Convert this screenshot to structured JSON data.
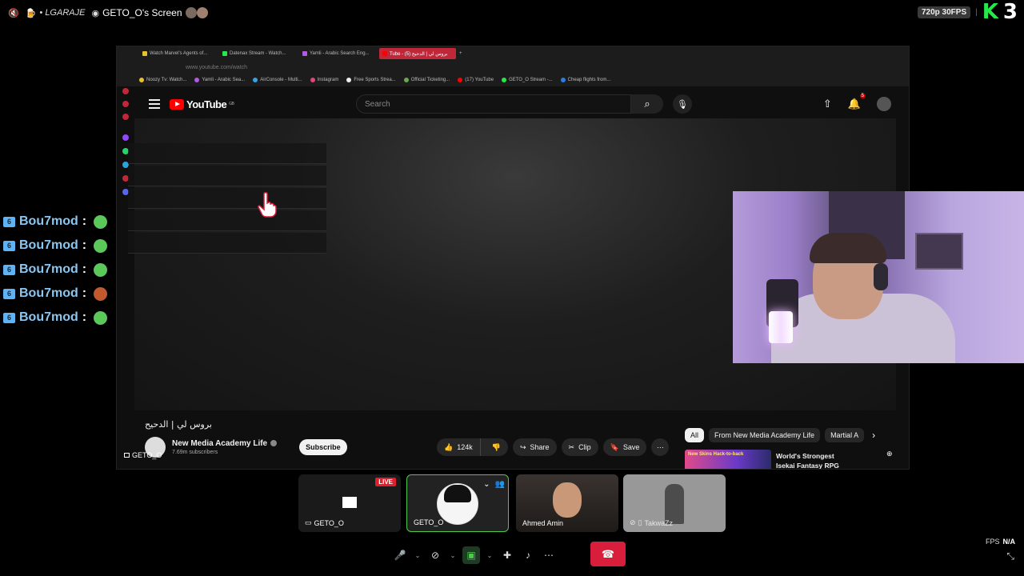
{
  "topbar": {
    "channel_label": "• LGARAJE",
    "screen_title": "GETO_O's Screen",
    "resolution": "720p 30FPS",
    "logo": "K",
    "logo_num": "3"
  },
  "browser": {
    "tabs": [
      {
        "label": "Watch Marvel's Agents of..."
      },
      {
        "label": "Datenax Stream - Watch..."
      },
      {
        "label": "Yamli - Arabic Search Eng..."
      },
      {
        "label": "Tube - بروس لي | الدحيح (5)"
      }
    ],
    "url": "www.youtube.com/watch",
    "bookmarks": [
      {
        "label": "Noozy Tv: Watch...",
        "color": "#e8c02b"
      },
      {
        "label": "Yamli - Arabic Sea...",
        "color": "#b05adf"
      },
      {
        "label": "AirConsole - Multi...",
        "color": "#3aa0e8"
      },
      {
        "label": "Instagram",
        "color": "#e0457b"
      },
      {
        "label": "Free Sports Strea...",
        "color": "#eeeeee"
      },
      {
        "label": "Official Ticketing...",
        "color": "#6aa84f"
      },
      {
        "label": "(17) YouTube",
        "color": "#ff0000"
      },
      {
        "label": "GETO_O Stream -...",
        "color": "#27e84a"
      },
      {
        "label": "Cheap flights from...",
        "color": "#2a7de1"
      }
    ]
  },
  "youtube": {
    "logo_text": "YouTube",
    "logo_region": "GB",
    "search_placeholder": "Search",
    "notification_count": "5",
    "video_title": "بروس لي | الدحيح",
    "channel_name": "New Media Academy Life",
    "subscribers": "7.69m subscribers",
    "subscribe_label": "Subscribe",
    "likes": "124k",
    "share_label": "Share",
    "clip_label": "Clip",
    "save_label": "Save",
    "chips": [
      {
        "label": "All",
        "selected": true
      },
      {
        "label": "From New Media Academy Life",
        "selected": false
      },
      {
        "label": "Martial A",
        "selected": false
      }
    ],
    "recommendation_title": "World's Strongest Isekai Fantasy RPG",
    "recommendation_thumb_text": "New Skins Hack-to-back"
  },
  "presenter_tag": "GETO_O",
  "chat": [
    {
      "user": "Bou7mod",
      "sep": ":"
    },
    {
      "user": "Bou7mod",
      "sep": ":"
    },
    {
      "user": "Bou7mod",
      "sep": ":"
    },
    {
      "user": "Bou7mod",
      "sep": ":"
    },
    {
      "user": "Bou7mod",
      "sep": ":"
    }
  ],
  "participants": [
    {
      "name": "GETO_O",
      "badge": "LIVE"
    },
    {
      "name": "GETO_O"
    },
    {
      "name": "Ahmed Amin"
    },
    {
      "name": "TakwaZz"
    }
  ],
  "stats": {
    "fps_label": "FPS",
    "fps_value": "N/A"
  },
  "colors": {
    "accent_green": "#27e84a",
    "hangup_red": "#d81e3a",
    "youtube_red": "#ff0000"
  }
}
